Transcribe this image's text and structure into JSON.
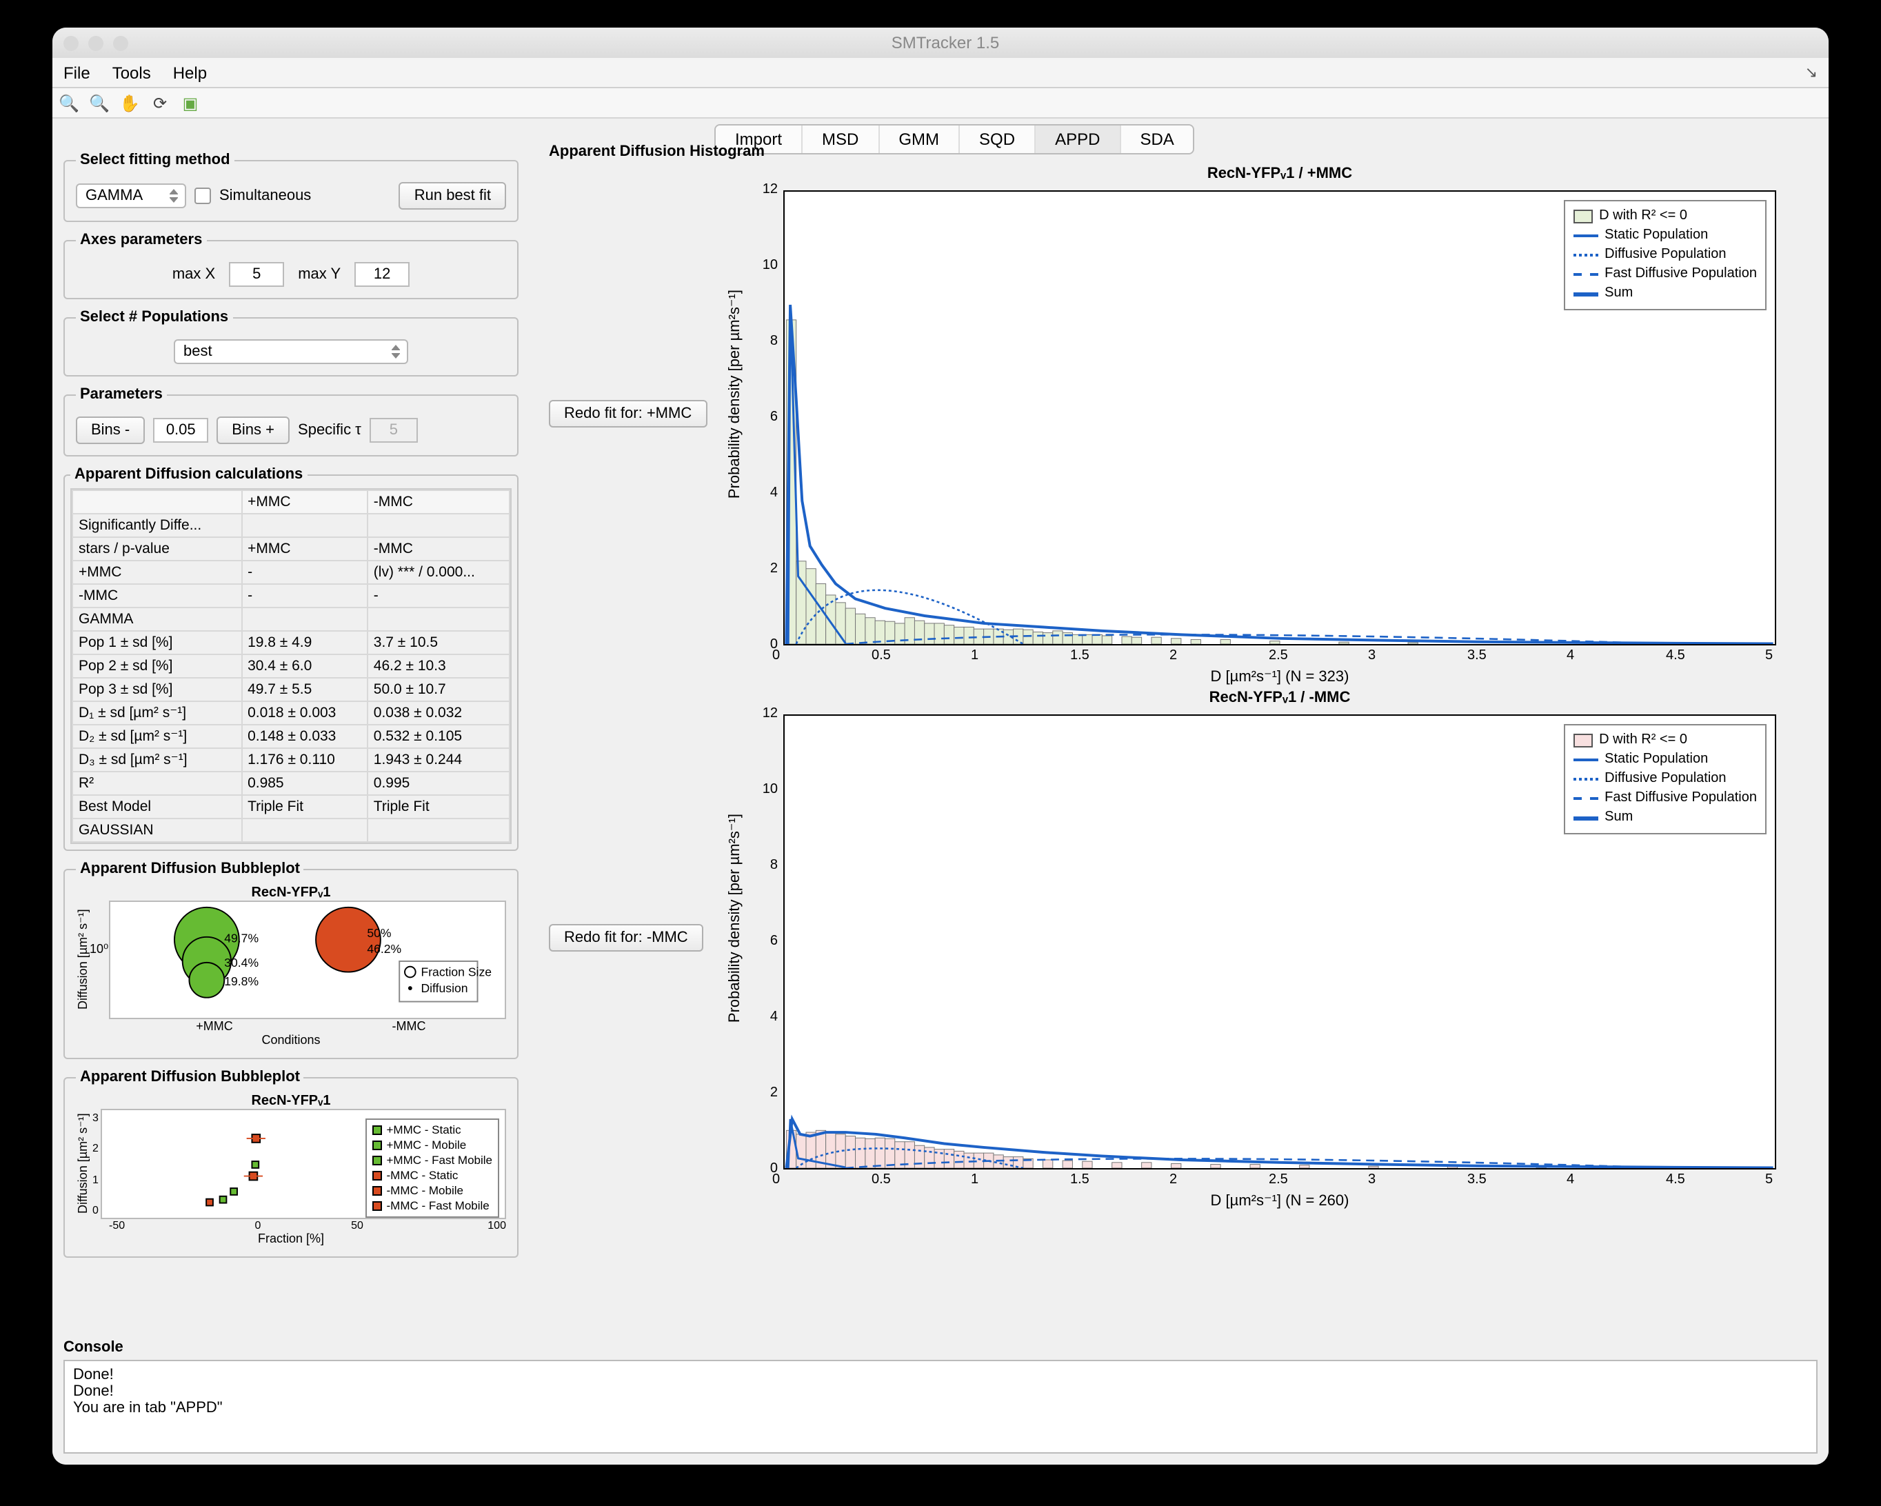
{
  "window_title": "SMTracker 1.5",
  "menu": {
    "file": "File",
    "tools": "Tools",
    "help": "Help"
  },
  "tabs": {
    "import": "Import",
    "msd": "MSD",
    "gmm": "GMM",
    "sqd": "SQD",
    "appd": "APPD",
    "sda": "SDA",
    "active": "APPD"
  },
  "fitting": {
    "legend": "Select fitting method",
    "method": "GAMMA",
    "sim_label": "Simultaneous",
    "run_btn": "Run best fit"
  },
  "axes": {
    "legend": "Axes parameters",
    "maxX_lbl": "max X",
    "maxX": "5",
    "maxY_lbl": "max Y",
    "maxY": "12"
  },
  "pops": {
    "legend": "Select # Populations",
    "value": "best"
  },
  "params": {
    "legend": "Parameters",
    "bins_minus": "Bins -",
    "binval": "0.05",
    "bins_plus": "Bins +",
    "spectau_lbl": "Specific τ",
    "spectau": "5"
  },
  "calc": {
    "legend": "Apparent Diffusion calculations",
    "cols": [
      "",
      "+MMC",
      "-MMC"
    ],
    "rows": [
      [
        "Significantly Diffe...",
        "",
        ""
      ],
      [
        "stars / p-value",
        "+MMC",
        "-MMC"
      ],
      [
        "+MMC",
        "-",
        "(lv) *** / 0.000..."
      ],
      [
        "-MMC",
        "-",
        "-"
      ],
      [
        "GAMMA",
        "",
        ""
      ],
      [
        "Pop 1 ± sd [%]",
        "19.8 ± 4.9",
        "3.7 ± 10.5"
      ],
      [
        "Pop 2 ± sd [%]",
        "30.4 ± 6.0",
        "46.2 ± 10.3"
      ],
      [
        "Pop 3 ± sd [%]",
        "49.7 ± 5.5",
        "50.0 ± 10.7"
      ],
      [
        "D₁ ± sd [µm² s⁻¹]",
        "0.018 ± 0.003",
        "0.038 ± 0.032"
      ],
      [
        "D₂ ± sd [µm² s⁻¹]",
        "0.148 ± 0.033",
        "0.532 ± 0.105"
      ],
      [
        "D₃ ± sd [µm² s⁻¹]",
        "1.176 ± 0.110",
        "1.943 ± 0.244"
      ],
      [
        "R²",
        "0.985",
        "0.995"
      ],
      [
        "Best Model",
        "Triple Fit",
        "Triple Fit"
      ],
      [
        "GAUSSIAN",
        "",
        ""
      ]
    ]
  },
  "bubble": {
    "legend": "Apparent Diffusion Bubbleplot",
    "title": "RecN-YFPᵥ1",
    "ylabel": "Diffusion [µm² s⁻¹]",
    "xlabel": "Conditions",
    "xcats": [
      "+MMC",
      "-MMC"
    ],
    "labels": [
      "49.7%",
      "30.4%",
      "19.8%",
      "50%",
      "46.2%"
    ],
    "legend_items": [
      "Fraction Size",
      "Diffusion"
    ]
  },
  "scatter": {
    "legend": "Apparent Diffusion Bubbleplot",
    "title": "RecN-YFPᵥ1",
    "ylabel": "Diffusion [µm² s⁻¹]",
    "xlabel": "Fraction [%]",
    "xticks": [
      "-50",
      "0",
      "50",
      "100"
    ],
    "yticks": [
      "0",
      "1",
      "2",
      "3"
    ],
    "legend_items": [
      "+MMC - Static",
      "+MMC - Mobile",
      "+MMC - Fast Mobile",
      "-MMC - Static",
      "-MMC - Mobile",
      "-MMC - Fast Mobile"
    ]
  },
  "main": {
    "title": "Apparent Diffusion Histogram",
    "redo1": "Redo fit for: +MMC",
    "redo2": "Redo fit for: -MMC",
    "chart1_title": "RecN-YFPᵥ1 / +MMC",
    "chart2_title": "RecN-YFPᵥ1 / -MMC",
    "ylabel": "Probability density [per µm²s⁻¹]",
    "xlabel1": "D [µm²s⁻¹] (N = 323)",
    "xlabel2": "D [µm²s⁻¹] (N = 260)",
    "yticks": [
      "0",
      "2",
      "4",
      "6",
      "8",
      "10",
      "12"
    ],
    "xticks": [
      "0",
      "0.5",
      "1",
      "1.5",
      "2",
      "2.5",
      "3",
      "3.5",
      "4",
      "4.5",
      "5"
    ],
    "legend_items": [
      "D with R² <= 0",
      "Static Population",
      "Diffusive Population",
      "Fast Diffusive Population",
      "Sum"
    ]
  },
  "console": {
    "label": "Console",
    "lines": [
      "Done!",
      "Done!",
      "You are in tab \"APPD\""
    ]
  },
  "chart_data": [
    {
      "type": "bar+line",
      "title": "RecN-YFPᵥ1 / +MMC",
      "xlabel": "D [µm²s⁻¹] (N = 323)",
      "ylabel": "Probability density [per µm²s⁻¹]",
      "xlim": [
        0,
        5
      ],
      "ylim": [
        0,
        12
      ],
      "bars_x": [
        0.025,
        0.075,
        0.125,
        0.175,
        0.225,
        0.275,
        0.325,
        0.375,
        0.425,
        0.475,
        0.525,
        0.575,
        0.625,
        0.675,
        0.725,
        0.775,
        0.825,
        0.875,
        0.925,
        0.975,
        1.025,
        1.075,
        1.125,
        1.175,
        1.225,
        1.275,
        1.325,
        1.375,
        1.425,
        1.475,
        1.525,
        1.575,
        1.625,
        1.725,
        1.775,
        1.875,
        1.975,
        2.075,
        2.225,
        2.475,
        2.825,
        3.175
      ],
      "bars_y": [
        8.6,
        2.2,
        2.0,
        1.6,
        1.3,
        1.1,
        0.95,
        0.8,
        0.7,
        0.62,
        0.6,
        0.55,
        0.7,
        0.62,
        0.55,
        0.55,
        0.5,
        0.45,
        0.45,
        0.4,
        0.4,
        0.4,
        0.38,
        0.4,
        0.38,
        0.32,
        0.3,
        0.35,
        0.3,
        0.25,
        0.25,
        0.25,
        0.22,
        0.2,
        0.18,
        0.18,
        0.15,
        0.12,
        0.12,
        0.08,
        0.05,
        0.04
      ],
      "curve_sum_x": [
        0,
        0.02,
        0.05,
        0.08,
        0.12,
        0.18,
        0.25,
        0.35,
        0.5,
        0.7,
        1.0,
        1.3,
        1.6,
        2.0,
        2.5,
        3.0,
        3.5,
        4.0,
        4.5,
        5.0
      ],
      "curve_sum_y": [
        0,
        9.0,
        6.5,
        3.8,
        2.6,
        2.1,
        1.6,
        1.2,
        0.95,
        0.75,
        0.55,
        0.45,
        0.35,
        0.25,
        0.15,
        0.1,
        0.06,
        0.04,
        0.02,
        0.01
      ],
      "legend": [
        "D with R² <= 0",
        "Static Population",
        "Diffusive Population",
        "Fast Diffusive Population",
        "Sum"
      ]
    },
    {
      "type": "bar+line",
      "title": "RecN-YFPᵥ1 / -MMC",
      "xlabel": "D [µm²s⁻¹] (N = 260)",
      "ylabel": "Probability density [per µm²s⁻¹]",
      "xlim": [
        0,
        5
      ],
      "ylim": [
        0,
        12
      ],
      "bars_x": [
        0.025,
        0.075,
        0.125,
        0.175,
        0.225,
        0.275,
        0.325,
        0.375,
        0.425,
        0.475,
        0.525,
        0.575,
        0.625,
        0.675,
        0.725,
        0.775,
        0.825,
        0.875,
        0.925,
        0.975,
        1.025,
        1.075,
        1.125,
        1.175,
        1.225,
        1.325,
        1.425,
        1.525,
        1.675,
        1.825,
        1.975,
        2.175,
        2.375,
        2.625,
        2.975,
        3.375,
        3.825
      ],
      "bars_y": [
        1.0,
        0.9,
        0.95,
        1.0,
        0.95,
        0.9,
        0.85,
        0.8,
        0.78,
        0.8,
        0.78,
        0.7,
        0.7,
        0.6,
        0.55,
        0.5,
        0.5,
        0.45,
        0.4,
        0.4,
        0.4,
        0.35,
        0.3,
        0.3,
        0.25,
        0.22,
        0.2,
        0.18,
        0.15,
        0.15,
        0.12,
        0.1,
        0.1,
        0.08,
        0.05,
        0.05,
        0.03
      ],
      "curve_sum_x": [
        0,
        0.03,
        0.07,
        0.12,
        0.2,
        0.3,
        0.45,
        0.6,
        0.8,
        1.0,
        1.3,
        1.6,
        2.0,
        2.5,
        3.0,
        3.5,
        4.0,
        4.5,
        5.0
      ],
      "curve_sum_y": [
        0,
        1.3,
        0.9,
        0.85,
        0.95,
        0.95,
        0.9,
        0.8,
        0.65,
        0.55,
        0.42,
        0.32,
        0.22,
        0.15,
        0.1,
        0.06,
        0.04,
        0.02,
        0.01
      ],
      "legend": [
        "D with R² <= 0",
        "Static Population",
        "Diffusive Population",
        "Fast Diffusive Population",
        "Sum"
      ]
    }
  ]
}
